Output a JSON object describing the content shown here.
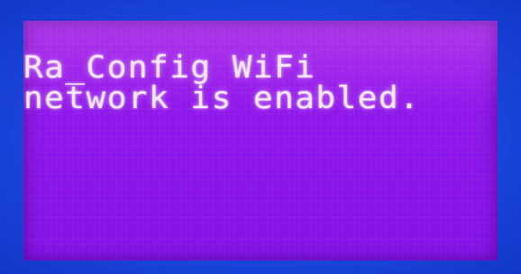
{
  "display": {
    "lines": [
      "Ra_Config WiFi",
      "network is enabled."
    ],
    "colors": {
      "bezel": "#1b46dc",
      "lcd_background": "#8f17ea",
      "text": "#f6e8ff"
    }
  }
}
